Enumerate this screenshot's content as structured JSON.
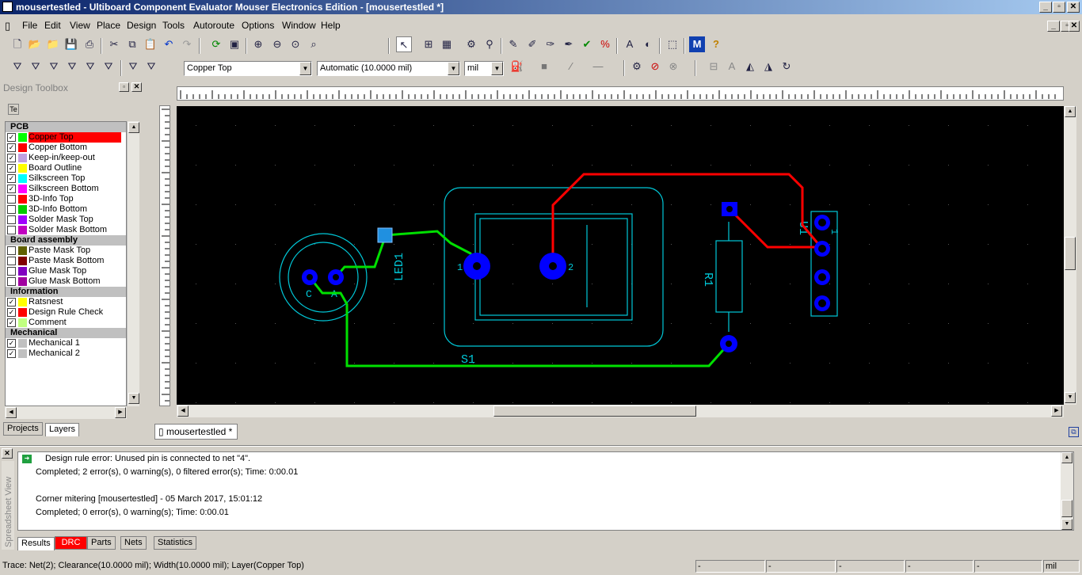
{
  "title": "mousertestled - Ultiboard Component Evaluator Mouser Electronics Edition - [mousertestled *]",
  "menu": [
    "File",
    "Edit",
    "View",
    "Place",
    "Design",
    "Tools",
    "Autoroute",
    "Options",
    "Window",
    "Help"
  ],
  "toolbar": {
    "layer_select": "Copper Top",
    "width_select": "Automatic (10.0000 mil)",
    "unit_select": "mil"
  },
  "toolbox": {
    "title": "Design Toolbox",
    "groups": [
      {
        "name": "PCB",
        "layers": [
          {
            "label": "Copper Top",
            "checked": true,
            "color": "#00ff00",
            "selected": true
          },
          {
            "label": "Copper Bottom",
            "checked": true,
            "color": "#ff0000"
          },
          {
            "label": "Keep-in/keep-out",
            "checked": true,
            "color": "#c0a0e0"
          },
          {
            "label": "Board Outline",
            "checked": true,
            "color": "#ffff00"
          },
          {
            "label": "Silkscreen Top",
            "checked": true,
            "color": "#00ffff"
          },
          {
            "label": "Silkscreen Bottom",
            "checked": true,
            "color": "#ff00ff"
          },
          {
            "label": "3D-Info Top",
            "checked": false,
            "color": "#ff0000"
          },
          {
            "label": "3D-Info Bottom",
            "checked": false,
            "color": "#00cc00"
          },
          {
            "label": "Solder Mask Top",
            "checked": false,
            "color": "#a000ff"
          },
          {
            "label": "Solder Mask Bottom",
            "checked": false,
            "color": "#c000c0"
          }
        ]
      },
      {
        "name": "Board assembly",
        "layers": [
          {
            "label": "Paste Mask Top",
            "checked": false,
            "color": "#606000"
          },
          {
            "label": "Paste Mask Bottom",
            "checked": false,
            "color": "#800000"
          },
          {
            "label": "Glue Mask Top",
            "checked": false,
            "color": "#8000c0"
          },
          {
            "label": "Glue Mask Bottom",
            "checked": false,
            "color": "#a000a0"
          }
        ]
      },
      {
        "name": "Information",
        "layers": [
          {
            "label": "Ratsnest",
            "checked": true,
            "color": "#ffff00"
          },
          {
            "label": "Design Rule Check",
            "checked": true,
            "color": "#ff0000"
          },
          {
            "label": "Comment",
            "checked": true,
            "color": "#c0ff80"
          }
        ]
      },
      {
        "name": "Mechanical",
        "layers": [
          {
            "label": "Mechanical 1",
            "checked": true,
            "color": "#c0c0c0"
          },
          {
            "label": "Mechanical 2",
            "checked": true,
            "color": "#c0c0c0"
          }
        ]
      }
    ],
    "tabs": [
      "Projects",
      "Layers"
    ]
  },
  "doc_tab": "mousertestled *",
  "pcb": {
    "labels": {
      "led": "LED1",
      "switch": "S1",
      "resistor": "R1",
      "connector": "U1",
      "pin_c": "C",
      "pin_a": "A",
      "pin1": "1",
      "pin2": "2",
      "conn1": "1"
    }
  },
  "output": {
    "side_label": "Spreadsheet View",
    "lines": [
      "Design rule error: Unused pin is connected to net \"4\".",
      "Completed;  2 error(s), 0 warning(s), 0 filtered error(s);  Time: 0:00.01",
      "Corner mitering [mousertestled]  - 05 March 2017, 15:01:12",
      "Completed;  0 error(s), 0 warning(s);  Time: 0:00.01"
    ],
    "tabs": [
      "Results",
      "DRC",
      "Parts",
      "Nets",
      "Statistics"
    ]
  },
  "status": {
    "text": "Trace: Net(2); Clearance(10.0000 mil); Width(10.0000 mil); Layer(Copper Top)",
    "fields": [
      "-",
      "-",
      "-",
      "-",
      "-",
      "-"
    ],
    "unit": "mil"
  }
}
